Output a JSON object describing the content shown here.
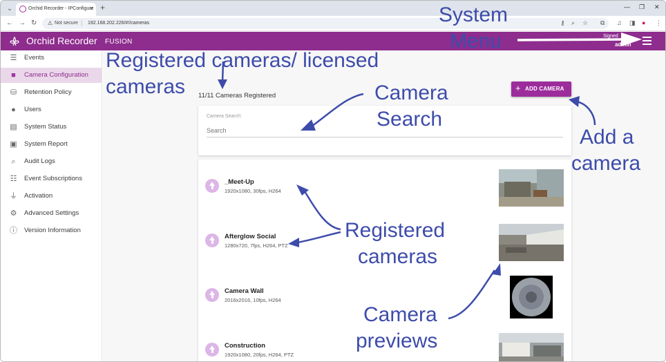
{
  "browser": {
    "tab_title": "Orchid Recorder - IPConfigure",
    "url_warning": "Not secure",
    "url": "192.168.202.226/#!/cameras"
  },
  "header": {
    "app_name": "Orchid Recorder",
    "edition": "FUSION",
    "signed_label": "Signed",
    "signed_user": "admin",
    "brand_color": "#8e2d8e"
  },
  "sidebar": {
    "items": [
      {
        "label": "Events",
        "icon": "events-icon",
        "active": false
      },
      {
        "label": "Camera Configuration",
        "icon": "video-camera-icon",
        "active": true
      },
      {
        "label": "Retention Policy",
        "icon": "database-icon",
        "active": false
      },
      {
        "label": "Users",
        "icon": "user-icon",
        "active": false
      },
      {
        "label": "System Status",
        "icon": "system-status-icon",
        "active": false
      },
      {
        "label": "System Report",
        "icon": "report-icon",
        "active": false
      },
      {
        "label": "Audit Logs",
        "icon": "audit-logs-icon",
        "active": false
      },
      {
        "label": "Event Subscriptions",
        "icon": "subscriptions-icon",
        "active": false
      },
      {
        "label": "Activation",
        "icon": "plug-icon",
        "active": false
      },
      {
        "label": "Advanced Settings",
        "icon": "gears-icon",
        "active": false
      },
      {
        "label": "Version Information",
        "icon": "info-icon",
        "active": false
      }
    ]
  },
  "main": {
    "camera_count": "11/11 Cameras Registered",
    "add_camera_label": "ADD CAMERA",
    "search": {
      "label": "Camera Search:",
      "placeholder": "Search"
    },
    "cameras": [
      {
        "name": "_Meet-Up",
        "specs": "1920x1080, 30fps, H264"
      },
      {
        "name": "Afterglow Social",
        "specs": "1280x720, 7fps, H264, PTZ"
      },
      {
        "name": "Camera Wall",
        "specs": "2016x2016, 10fps, H264"
      },
      {
        "name": "Construction",
        "specs": "1920x1080, 20fps, H264, PTZ"
      }
    ]
  },
  "annotations": {
    "system_menu_1": "System",
    "system_menu_2": "Menu",
    "registered_licensed_1": "Registered cameras/ licensed",
    "registered_licensed_2": "cameras",
    "camera_search_1": "Camera",
    "camera_search_2": "Search",
    "add_camera_1": "Add a",
    "add_camera_2": "camera",
    "registered_cameras_1": "Registered",
    "registered_cameras_2": "cameras",
    "camera_previews_1": "Camera",
    "camera_previews_2": "previews",
    "color": "#3d4caa"
  }
}
